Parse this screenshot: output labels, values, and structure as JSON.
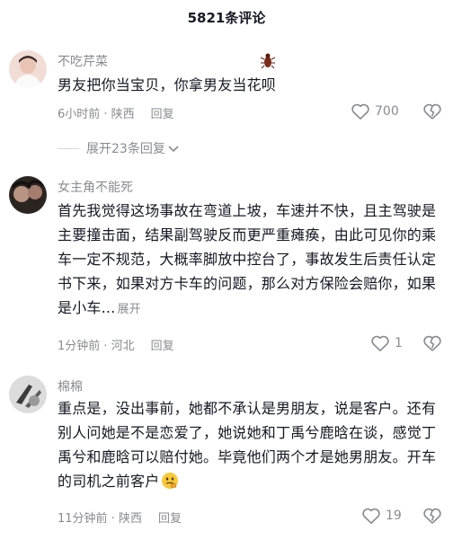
{
  "header": {
    "title": "5821条评论"
  },
  "comments": [
    {
      "username": "不吃芹菜",
      "content": "男友把你当宝贝，你拿男友当花呗",
      "time_location": "6小时前 · 陕西",
      "reply_label": "回复",
      "like_count": "700",
      "expand_replies": "展开23条回复"
    },
    {
      "username": "女主角不能死",
      "content": "首先我觉得这场事故在弯道上坡，车速并不快，且主驾驶是主要撞击面，结果副驾驶反而更严重瘫痪，由此可见你的乘车一定不规范，大概率脚放中控台了，事故发生后责任认定书下来，如果对方卡车的问题，那么对方保险会赔你，如果是小车...",
      "expand_text": "展开",
      "time_location": "1分钟前 · 河北",
      "reply_label": "回复",
      "like_count": "1"
    },
    {
      "username": "棉棉",
      "content": "重点是，没出事前，她都不承认是男朋友，说是客户。还有别人问她是不是恋爱了，她说她和丁禹兮鹿晗在谈，感觉丁禹兮和鹿晗可以赔付她。毕竟他们两个才是她男朋友。开车的司机之前客户",
      "time_location": "11分钟前 · 陕西",
      "reply_label": "回复",
      "like_count": "19"
    }
  ],
  "icons": {
    "like": "heart-outline-icon",
    "dislike": "broken-heart-outline-icon",
    "expand": "chevron-down-icon",
    "emoji": "thinking-face-emoji",
    "decoration": "bug-icon"
  },
  "colors": {
    "text_primary": "#161823",
    "text_secondary": "#8a8b91",
    "divider": "#d6d6d9"
  }
}
